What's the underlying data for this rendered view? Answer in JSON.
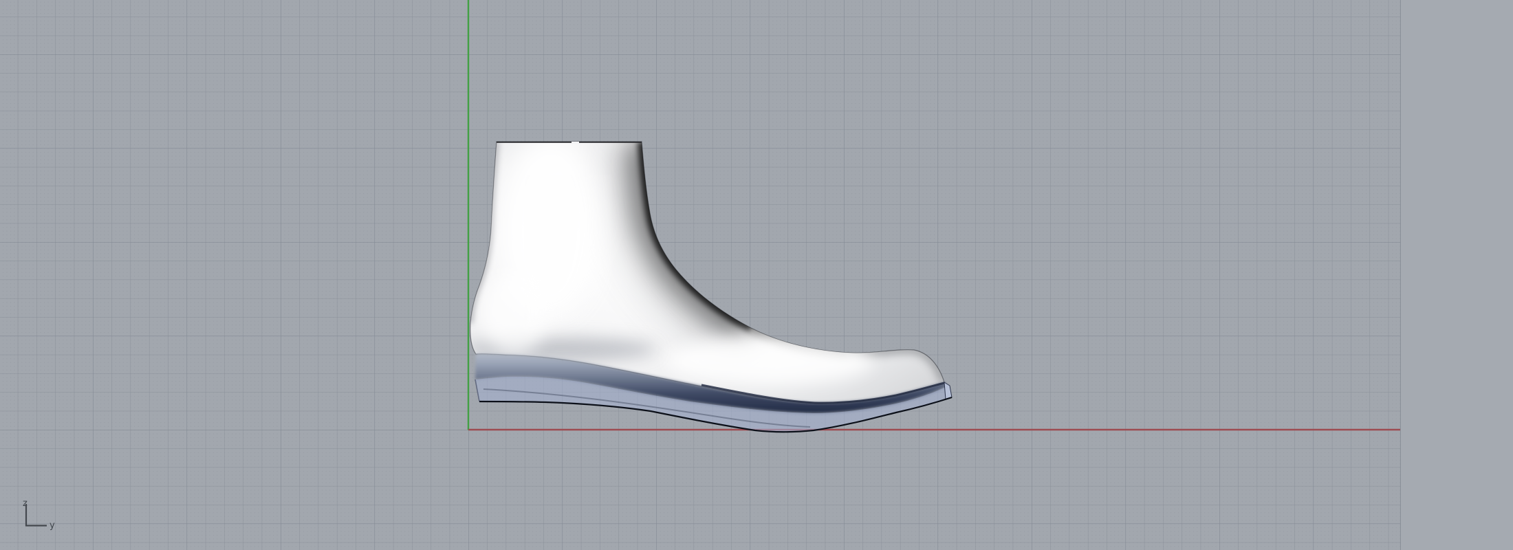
{
  "viewport": {
    "kind": "cad-3d-viewport-side-view",
    "axis_indicator": {
      "up_label": "z",
      "right_label": "y"
    },
    "grid": {
      "background": "#a2a7ae",
      "plain_right_background": "#a5aab1",
      "minor_dot_color": "#8f959e",
      "major_line_color": "#8b919a",
      "supermajor_line_color": "#818892"
    },
    "axes": {
      "z_axis_color": "#42a044",
      "y_axis_color": "#9d4b51"
    },
    "axis_icon_color": "#44484e",
    "axis_label_color": "#3f444a"
  },
  "scene": {
    "objects": [
      {
        "name": "shoe-last",
        "body_color": "#f7f7f8",
        "edge_color": "rgba(40,42,48,0.55)"
      },
      {
        "name": "shoe-sole",
        "fill": "rgba(163,176,206,0.58)",
        "front_face": "#b7c1d8",
        "shadow_navy": "#1e2740",
        "outline": "#0c1019"
      }
    ]
  }
}
